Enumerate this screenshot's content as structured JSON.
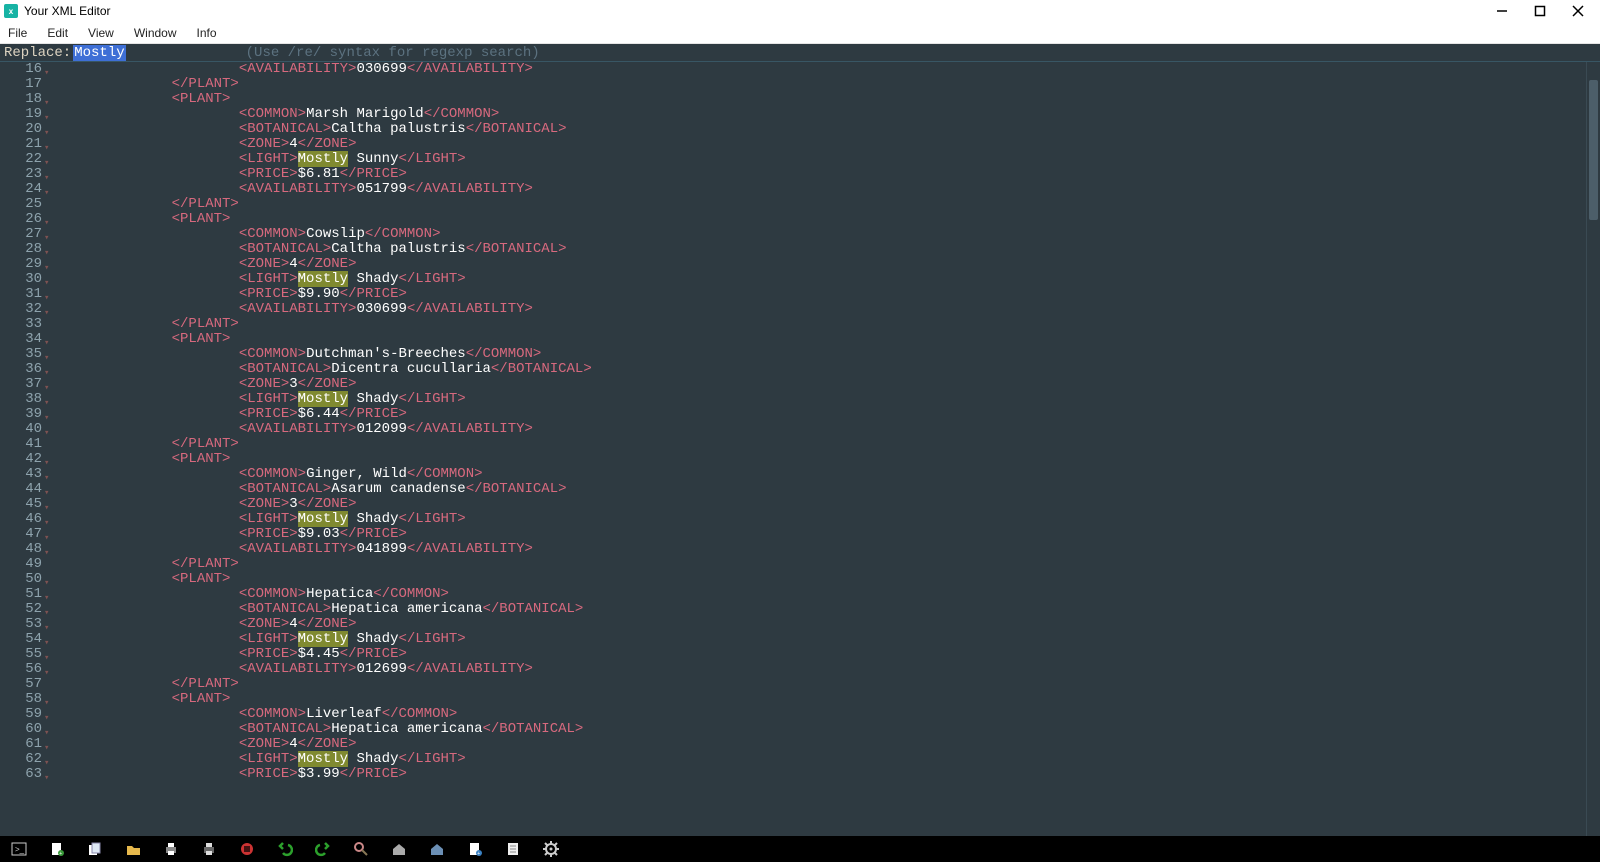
{
  "title": "Your XML Editor",
  "menu": [
    "File",
    "Edit",
    "View",
    "Window",
    "Info"
  ],
  "replace": {
    "label": "Replace: ",
    "value": "Mostly",
    "hint": "(Use /re/ syntax for regexp search)"
  },
  "highlightTerm": "Mostly",
  "colors": {
    "bg": "#2e3a41",
    "tag": "#d7697e",
    "text": "#ffffff",
    "highlight": "#808a30",
    "selection": "#3e6fd6"
  },
  "startLineNumber": 16,
  "code_lines": [
    {
      "n": 16,
      "indent": 4,
      "tokens": [
        {
          "t": "tag-open",
          "v": "<AVAILABILITY>"
        },
        {
          "t": "txt",
          "v": "030699"
        },
        {
          "t": "tag-close",
          "v": "</AVAILABILITY>"
        }
      ]
    },
    {
      "n": 17,
      "indent": 2,
      "tokens": [
        {
          "t": "tag-close",
          "v": "</PLANT>"
        }
      ]
    },
    {
      "n": 18,
      "indent": 2,
      "tokens": [
        {
          "t": "tag-open",
          "v": "<PLANT>"
        }
      ]
    },
    {
      "n": 19,
      "indent": 4,
      "tokens": [
        {
          "t": "tag-open",
          "v": "<COMMON>"
        },
        {
          "t": "txt",
          "v": "Marsh Marigold"
        },
        {
          "t": "tag-close",
          "v": "</COMMON>"
        }
      ]
    },
    {
      "n": 20,
      "indent": 4,
      "tokens": [
        {
          "t": "tag-open",
          "v": "<BOTANICAL>"
        },
        {
          "t": "txt",
          "v": "Caltha palustris"
        },
        {
          "t": "tag-close",
          "v": "</BOTANICAL>"
        }
      ]
    },
    {
      "n": 21,
      "indent": 4,
      "tokens": [
        {
          "t": "tag-open",
          "v": "<ZONE>"
        },
        {
          "t": "txt",
          "v": "4"
        },
        {
          "t": "tag-close",
          "v": "</ZONE>"
        }
      ]
    },
    {
      "n": 22,
      "indent": 4,
      "tokens": [
        {
          "t": "tag-open",
          "v": "<LIGHT>"
        },
        {
          "t": "hl",
          "v": "Mostly"
        },
        {
          "t": "txt",
          "v": " Sunny"
        },
        {
          "t": "tag-close",
          "v": "</LIGHT>"
        }
      ]
    },
    {
      "n": 23,
      "indent": 4,
      "tokens": [
        {
          "t": "tag-open",
          "v": "<PRICE>"
        },
        {
          "t": "txt",
          "v": "$6.81"
        },
        {
          "t": "tag-close",
          "v": "</PRICE>"
        }
      ]
    },
    {
      "n": 24,
      "indent": 4,
      "tokens": [
        {
          "t": "tag-open",
          "v": "<AVAILABILITY>"
        },
        {
          "t": "txt",
          "v": "051799"
        },
        {
          "t": "tag-close",
          "v": "</AVAILABILITY>"
        }
      ]
    },
    {
      "n": 25,
      "indent": 2,
      "tokens": [
        {
          "t": "tag-close",
          "v": "</PLANT>"
        }
      ]
    },
    {
      "n": 26,
      "indent": 2,
      "tokens": [
        {
          "t": "tag-open",
          "v": "<PLANT>"
        }
      ]
    },
    {
      "n": 27,
      "indent": 4,
      "tokens": [
        {
          "t": "tag-open",
          "v": "<COMMON>"
        },
        {
          "t": "txt",
          "v": "Cowslip"
        },
        {
          "t": "tag-close",
          "v": "</COMMON>"
        }
      ]
    },
    {
      "n": 28,
      "indent": 4,
      "tokens": [
        {
          "t": "tag-open",
          "v": "<BOTANICAL>"
        },
        {
          "t": "txt",
          "v": "Caltha palustris"
        },
        {
          "t": "tag-close",
          "v": "</BOTANICAL>"
        }
      ]
    },
    {
      "n": 29,
      "indent": 4,
      "tokens": [
        {
          "t": "tag-open",
          "v": "<ZONE>"
        },
        {
          "t": "txt",
          "v": "4"
        },
        {
          "t": "tag-close",
          "v": "</ZONE>"
        }
      ]
    },
    {
      "n": 30,
      "indent": 4,
      "tokens": [
        {
          "t": "tag-open",
          "v": "<LIGHT>"
        },
        {
          "t": "hl",
          "v": "Mostly"
        },
        {
          "t": "txt",
          "v": " Shady"
        },
        {
          "t": "tag-close",
          "v": "</LIGHT>"
        }
      ]
    },
    {
      "n": 31,
      "indent": 4,
      "tokens": [
        {
          "t": "tag-open",
          "v": "<PRICE>"
        },
        {
          "t": "txt",
          "v": "$9.90"
        },
        {
          "t": "tag-close",
          "v": "</PRICE>"
        }
      ]
    },
    {
      "n": 32,
      "indent": 4,
      "tokens": [
        {
          "t": "tag-open",
          "v": "<AVAILABILITY>"
        },
        {
          "t": "txt",
          "v": "030699"
        },
        {
          "t": "tag-close",
          "v": "</AVAILABILITY>"
        }
      ]
    },
    {
      "n": 33,
      "indent": 2,
      "tokens": [
        {
          "t": "tag-close",
          "v": "</PLANT>"
        }
      ]
    },
    {
      "n": 34,
      "indent": 2,
      "tokens": [
        {
          "t": "tag-open",
          "v": "<PLANT>"
        }
      ]
    },
    {
      "n": 35,
      "indent": 4,
      "tokens": [
        {
          "t": "tag-open",
          "v": "<COMMON>"
        },
        {
          "t": "txt",
          "v": "Dutchman's-Breeches"
        },
        {
          "t": "tag-close",
          "v": "</COMMON>"
        }
      ]
    },
    {
      "n": 36,
      "indent": 4,
      "tokens": [
        {
          "t": "tag-open",
          "v": "<BOTANICAL>"
        },
        {
          "t": "txt",
          "v": "Dicentra cucullaria"
        },
        {
          "t": "tag-close",
          "v": "</BOTANICAL>"
        }
      ]
    },
    {
      "n": 37,
      "indent": 4,
      "tokens": [
        {
          "t": "tag-open",
          "v": "<ZONE>"
        },
        {
          "t": "txt",
          "v": "3"
        },
        {
          "t": "tag-close",
          "v": "</ZONE>"
        }
      ]
    },
    {
      "n": 38,
      "indent": 4,
      "tokens": [
        {
          "t": "tag-open",
          "v": "<LIGHT>"
        },
        {
          "t": "hl",
          "v": "Mostly"
        },
        {
          "t": "txt",
          "v": " Shady"
        },
        {
          "t": "tag-close",
          "v": "</LIGHT>"
        }
      ]
    },
    {
      "n": 39,
      "indent": 4,
      "tokens": [
        {
          "t": "tag-open",
          "v": "<PRICE>"
        },
        {
          "t": "txt",
          "v": "$6.44"
        },
        {
          "t": "tag-close",
          "v": "</PRICE>"
        }
      ]
    },
    {
      "n": 40,
      "indent": 4,
      "tokens": [
        {
          "t": "tag-open",
          "v": "<AVAILABILITY>"
        },
        {
          "t": "txt",
          "v": "012099"
        },
        {
          "t": "tag-close",
          "v": "</AVAILABILITY>"
        }
      ]
    },
    {
      "n": 41,
      "indent": 2,
      "tokens": [
        {
          "t": "tag-close",
          "v": "</PLANT>"
        }
      ]
    },
    {
      "n": 42,
      "indent": 2,
      "tokens": [
        {
          "t": "tag-open",
          "v": "<PLANT>"
        }
      ]
    },
    {
      "n": 43,
      "indent": 4,
      "tokens": [
        {
          "t": "tag-open",
          "v": "<COMMON>"
        },
        {
          "t": "txt",
          "v": "Ginger, Wild"
        },
        {
          "t": "tag-close",
          "v": "</COMMON>"
        }
      ]
    },
    {
      "n": 44,
      "indent": 4,
      "tokens": [
        {
          "t": "tag-open",
          "v": "<BOTANICAL>"
        },
        {
          "t": "txt",
          "v": "Asarum canadense"
        },
        {
          "t": "tag-close",
          "v": "</BOTANICAL>"
        }
      ]
    },
    {
      "n": 45,
      "indent": 4,
      "tokens": [
        {
          "t": "tag-open",
          "v": "<ZONE>"
        },
        {
          "t": "txt",
          "v": "3"
        },
        {
          "t": "tag-close",
          "v": "</ZONE>"
        }
      ]
    },
    {
      "n": 46,
      "indent": 4,
      "tokens": [
        {
          "t": "tag-open",
          "v": "<LIGHT>"
        },
        {
          "t": "hl",
          "v": "Mostly"
        },
        {
          "t": "txt",
          "v": " Shady"
        },
        {
          "t": "tag-close",
          "v": "</LIGHT>"
        }
      ]
    },
    {
      "n": 47,
      "indent": 4,
      "tokens": [
        {
          "t": "tag-open",
          "v": "<PRICE>"
        },
        {
          "t": "txt",
          "v": "$9.03"
        },
        {
          "t": "tag-close",
          "v": "</PRICE>"
        }
      ]
    },
    {
      "n": 48,
      "indent": 4,
      "tokens": [
        {
          "t": "tag-open",
          "v": "<AVAILABILITY>"
        },
        {
          "t": "txt",
          "v": "041899"
        },
        {
          "t": "tag-close",
          "v": "</AVAILABILITY>"
        }
      ]
    },
    {
      "n": 49,
      "indent": 2,
      "tokens": [
        {
          "t": "tag-close",
          "v": "</PLANT>"
        }
      ]
    },
    {
      "n": 50,
      "indent": 2,
      "tokens": [
        {
          "t": "tag-open",
          "v": "<PLANT>"
        }
      ]
    },
    {
      "n": 51,
      "indent": 4,
      "tokens": [
        {
          "t": "tag-open",
          "v": "<COMMON>"
        },
        {
          "t": "txt",
          "v": "Hepatica"
        },
        {
          "t": "tag-close",
          "v": "</COMMON>"
        }
      ]
    },
    {
      "n": 52,
      "indent": 4,
      "tokens": [
        {
          "t": "tag-open",
          "v": "<BOTANICAL>"
        },
        {
          "t": "txt",
          "v": "Hepatica americana"
        },
        {
          "t": "tag-close",
          "v": "</BOTANICAL>"
        }
      ]
    },
    {
      "n": 53,
      "indent": 4,
      "tokens": [
        {
          "t": "tag-open",
          "v": "<ZONE>"
        },
        {
          "t": "txt",
          "v": "4"
        },
        {
          "t": "tag-close",
          "v": "</ZONE>"
        }
      ]
    },
    {
      "n": 54,
      "indent": 4,
      "tokens": [
        {
          "t": "tag-open",
          "v": "<LIGHT>"
        },
        {
          "t": "hl",
          "v": "Mostly"
        },
        {
          "t": "txt",
          "v": " Shady"
        },
        {
          "t": "tag-close",
          "v": "</LIGHT>"
        }
      ]
    },
    {
      "n": 55,
      "indent": 4,
      "tokens": [
        {
          "t": "tag-open",
          "v": "<PRICE>"
        },
        {
          "t": "txt",
          "v": "$4.45"
        },
        {
          "t": "tag-close",
          "v": "</PRICE>"
        }
      ]
    },
    {
      "n": 56,
      "indent": 4,
      "tokens": [
        {
          "t": "tag-open",
          "v": "<AVAILABILITY>"
        },
        {
          "t": "txt",
          "v": "012699"
        },
        {
          "t": "tag-close",
          "v": "</AVAILABILITY>"
        }
      ]
    },
    {
      "n": 57,
      "indent": 2,
      "tokens": [
        {
          "t": "tag-close",
          "v": "</PLANT>"
        }
      ]
    },
    {
      "n": 58,
      "indent": 2,
      "tokens": [
        {
          "t": "tag-open",
          "v": "<PLANT>"
        }
      ]
    },
    {
      "n": 59,
      "indent": 4,
      "tokens": [
        {
          "t": "tag-open",
          "v": "<COMMON>"
        },
        {
          "t": "txt",
          "v": "Liverleaf"
        },
        {
          "t": "tag-close",
          "v": "</COMMON>"
        }
      ]
    },
    {
      "n": 60,
      "indent": 4,
      "tokens": [
        {
          "t": "tag-open",
          "v": "<BOTANICAL>"
        },
        {
          "t": "txt",
          "v": "Hepatica americana"
        },
        {
          "t": "tag-close",
          "v": "</BOTANICAL>"
        }
      ]
    },
    {
      "n": 61,
      "indent": 4,
      "tokens": [
        {
          "t": "tag-open",
          "v": "<ZONE>"
        },
        {
          "t": "txt",
          "v": "4"
        },
        {
          "t": "tag-close",
          "v": "</ZONE>"
        }
      ]
    },
    {
      "n": 62,
      "indent": 4,
      "tokens": [
        {
          "t": "tag-open",
          "v": "<LIGHT>"
        },
        {
          "t": "hl",
          "v": "Mostly"
        },
        {
          "t": "txt",
          "v": " Shady"
        },
        {
          "t": "tag-close",
          "v": "</LIGHT>"
        }
      ]
    },
    {
      "n": 63,
      "indent": 4,
      "tokens": [
        {
          "t": "tag-open",
          "v": "<PRICE>"
        },
        {
          "t": "txt",
          "v": "$3.99"
        },
        {
          "t": "tag-close",
          "v": "</PRICE>"
        }
      ]
    }
  ],
  "nofold_lines": [
    17,
    25,
    33,
    41,
    49,
    57
  ],
  "toolbar_icons": [
    "terminal-icon",
    "new-file-icon",
    "files-icon",
    "folder-icon",
    "print-icon",
    "printer2-icon",
    "stop-icon",
    "undo-icon",
    "redo-icon",
    "search-icon",
    "home-icon",
    "app-home-icon",
    "page-plus-icon",
    "page-icon",
    "gear-icon"
  ]
}
